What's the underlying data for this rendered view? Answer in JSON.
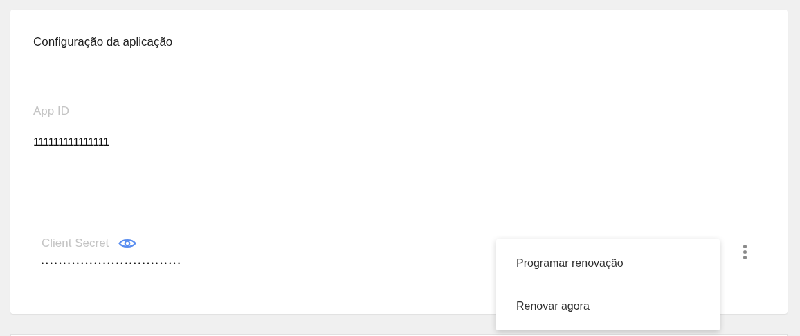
{
  "card": {
    "title": "Configuração da aplicação"
  },
  "app_id": {
    "label": "App ID",
    "value": "111111111111111"
  },
  "client_secret": {
    "label": "Client Secret",
    "value": "••••••••••••••••••••••••••••••••",
    "revealed": false
  },
  "menu": {
    "open": true,
    "items": [
      {
        "label": "Programar renovação"
      },
      {
        "label": "Renovar agora"
      }
    ]
  }
}
